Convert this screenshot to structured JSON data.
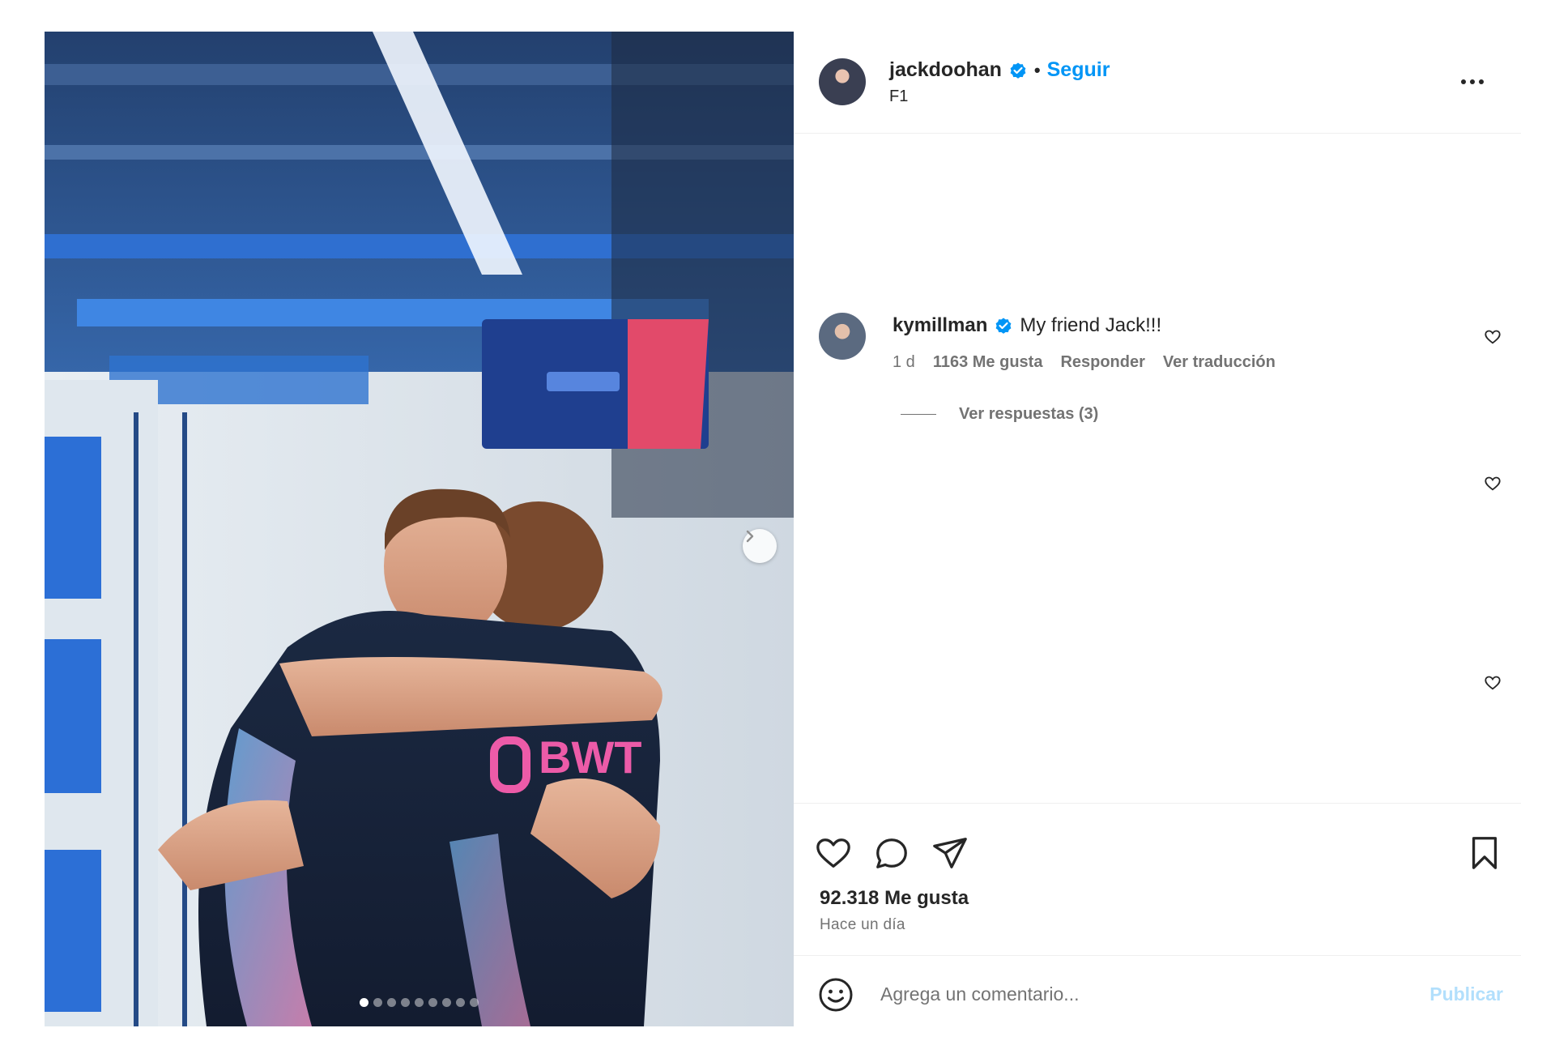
{
  "post": {
    "author": {
      "username": "jackdoohan",
      "separator": "•",
      "follow_label": "Seguir",
      "location": "F1",
      "verified_icon": "verified-badge-icon",
      "verified_color": "#0095f6"
    },
    "media": {
      "carousel_count": 9,
      "active_index": 0,
      "next_icon": "chevron-right-icon"
    },
    "comments": [
      {
        "username": "kymillman",
        "text": "My friend Jack!!!",
        "age": "1 d",
        "likes": "1163 Me gusta",
        "reply_label": "Responder",
        "translate_label": "Ver traducción",
        "view_replies": "Ver respuestas (3)"
      }
    ],
    "actions": {
      "like_icon": "heart-icon",
      "comment_icon": "comment-bubble-icon",
      "share_icon": "paper-plane-icon",
      "save_icon": "bookmark-icon",
      "likes_count": "92.318 Me gusta",
      "timestamp": "Hace un día"
    },
    "composer": {
      "placeholder": "Agrega un comentario...",
      "publish_label": "Publicar",
      "emoji_icon": "emoji-icon"
    },
    "colors": {
      "accent": "#0095f6",
      "publish_disabled": "#b2dffc",
      "secondary_text": "#737373",
      "primary_text": "#262626"
    }
  }
}
